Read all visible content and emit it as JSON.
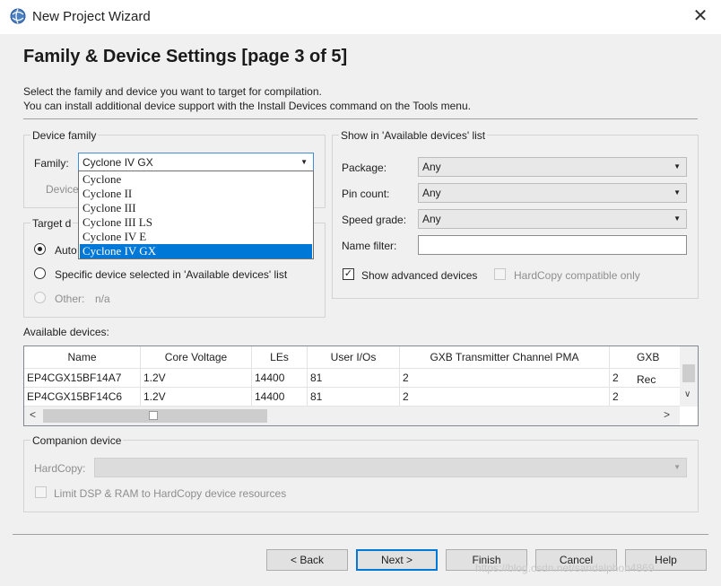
{
  "window": {
    "title": "New Project Wizard",
    "close_glyph": "✕",
    "app_icon": "globe-icon"
  },
  "header": {
    "heading": "Family & Device Settings [page 3 of 5]",
    "desc_line1": "Select the family and device you want to target for compilation.",
    "desc_line2": "You can install additional device support with the Install Devices command on the Tools menu."
  },
  "device_family": {
    "group_title": "Device family",
    "family_label": "Family:",
    "family_value": "Cyclone IV GX",
    "device_label": "Device",
    "dropdown_options": [
      "Cyclone",
      "Cyclone II",
      "Cyclone III",
      "Cyclone III LS",
      "Cyclone IV E",
      "Cyclone IV GX"
    ],
    "selected_option": "Cyclone IV GX"
  },
  "target_device": {
    "group_title": "Target d",
    "auto_label": "Auto",
    "specific_label": "Specific device selected in 'Available devices' list",
    "other_label": "Other:",
    "other_value": "n/a"
  },
  "show_in_list": {
    "group_title": "Show in 'Available devices' list",
    "package_label": "Package:",
    "package_value": "Any",
    "pin_count_label": "Pin count:",
    "pin_count_value": "Any",
    "speed_grade_label": "Speed grade:",
    "speed_grade_value": "Any",
    "name_filter_label": "Name filter:",
    "name_filter_value": "",
    "show_advanced_label": "Show advanced devices",
    "show_advanced_checked": true,
    "hardcopy_label": "HardCopy compatible only",
    "hardcopy_checked": false
  },
  "available_devices": {
    "label": "Available devices:",
    "columns": [
      "Name",
      "Core Voltage",
      "LEs",
      "User I/Os",
      "GXB Transmitter Channel PMA",
      "GXB Rec"
    ],
    "rows": [
      [
        "EP4CGX15BF14A7",
        "1.2V",
        "14400",
        "81",
        "2",
        "2"
      ],
      [
        "EP4CGX15BF14C6",
        "1.2V",
        "14400",
        "81",
        "2",
        "2"
      ]
    ]
  },
  "companion": {
    "group_title": "Companion device",
    "hardcopy_label": "HardCopy:",
    "limit_label": "Limit DSP & RAM to HardCopy device resources"
  },
  "buttons": {
    "back": "< Back",
    "next": "Next >",
    "finish": "Finish",
    "cancel": "Cancel",
    "help": "Help"
  },
  "watermark": "https://blog.csdn.net/sandalphon4869",
  "colors": {
    "accent": "#0078d7",
    "background": "#f0f0f0"
  }
}
